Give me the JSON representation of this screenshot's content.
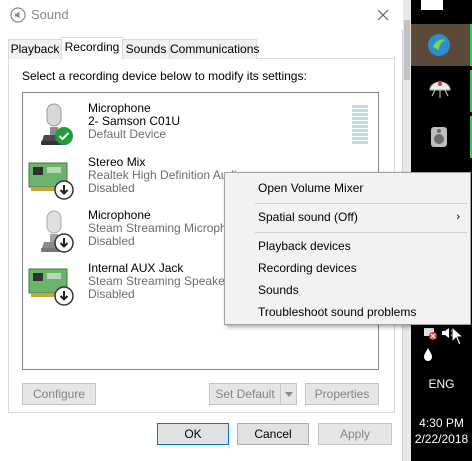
{
  "window": {
    "title": "Sound",
    "close_label": "✕"
  },
  "tabs": [
    {
      "label": "Playback",
      "active": false
    },
    {
      "label": "Recording",
      "active": true
    },
    {
      "label": "Sounds",
      "active": false
    },
    {
      "label": "Communications",
      "active": false
    }
  ],
  "instruction": "Select a recording device below to modify its settings:",
  "devices": [
    {
      "name": "Microphone",
      "detail": "2- Samson C01U",
      "status": "Default Device",
      "icon": "microphone-icon",
      "badge": "default-check-badge"
    },
    {
      "name": "Stereo Mix",
      "detail": "Realtek High Definition Audio",
      "status": "Disabled",
      "icon": "sound-card-icon",
      "badge": "disabled-arrow-badge"
    },
    {
      "name": "Microphone",
      "detail": "Steam Streaming Microphone",
      "status": "Disabled",
      "icon": "microphone-icon",
      "badge": "disabled-arrow-badge"
    },
    {
      "name": "Internal AUX Jack",
      "detail": "Steam Streaming Speakers",
      "status": "Disabled",
      "icon": "sound-card-icon",
      "badge": "disabled-arrow-badge"
    }
  ],
  "buttons": {
    "configure": "Configure",
    "set_default": "Set Default",
    "properties": "Properties",
    "ok": "OK",
    "cancel": "Cancel",
    "apply": "Apply"
  },
  "context_menu": {
    "items": [
      "Open Volume Mixer",
      "Spatial sound (Off)",
      "Playback devices",
      "Recording devices",
      "Sounds",
      "Troubleshoot sound problems"
    ],
    "submenu_arrow": "›"
  },
  "tray": {
    "language": "ENG",
    "time": "4:30 PM",
    "date": "2/22/2018"
  },
  "colors": {
    "accent": "#0078d7",
    "check_green": "#1e9e3a",
    "taskbar": "#000000",
    "indicator_green": "#2bd06b"
  }
}
